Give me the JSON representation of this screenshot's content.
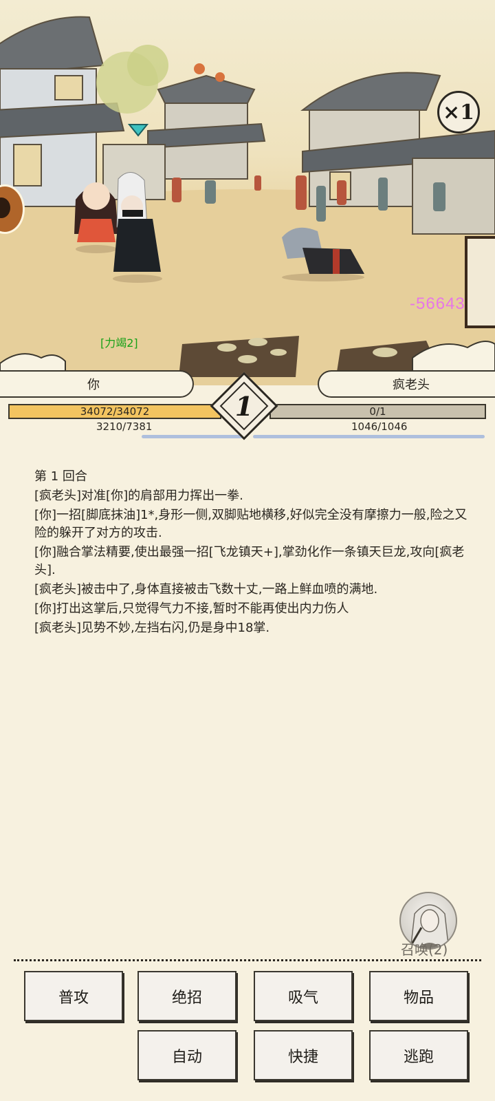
{
  "scene": {
    "speed_label": "×1",
    "damage_text": "-56643",
    "player_buff": "[力竭2]"
  },
  "player": {
    "name": "你",
    "hp_text": "34072/34072",
    "hp_fraction": 1.0,
    "mp_text": "3210/7381",
    "mp_fraction": 0.435
  },
  "enemy": {
    "name": "疯老头",
    "hp_text": "0/1",
    "hp_fraction": 0.0,
    "mp_text": "1046/1046",
    "mp_fraction": 1.0
  },
  "round": {
    "number": "1"
  },
  "log": {
    "round_title": "第 1 回合",
    "lines": [
      "[疯老头]对准[你]的肩部用力挥出一拳.",
      "[你]一招[脚底抹油]1*,身形一侧,双脚贴地横移,好似完全没有摩擦力一般,险之又险的躲开了对方的攻击.",
      "[你]融合掌法精要,使出最强一招[飞龙镇天+],掌劲化作一条镇天巨龙,攻向[疯老头].",
      "[疯老头]被击中了,身体直接被击飞数十丈,一路上鲜血喷的满地.",
      "[你]打出这掌后,只觉得气力不接,暂时不能再使出内力伤人",
      "[疯老头]见势不妙,左挡右闪,仍是身中18掌."
    ]
  },
  "summon": {
    "label": "召唤(2)"
  },
  "actions": {
    "attack": "普攻",
    "ultimate": "绝招",
    "breathe": "吸气",
    "items": "物品",
    "auto": "自动",
    "shortcut": "快捷",
    "flee": "逃跑"
  },
  "colors": {
    "hp_player": "#f3c460",
    "hp_enemy": "#b5aa94",
    "mp": "#aebfdd",
    "damage": "#e777e6",
    "buff": "#18a118",
    "background": "#f7f1df"
  }
}
